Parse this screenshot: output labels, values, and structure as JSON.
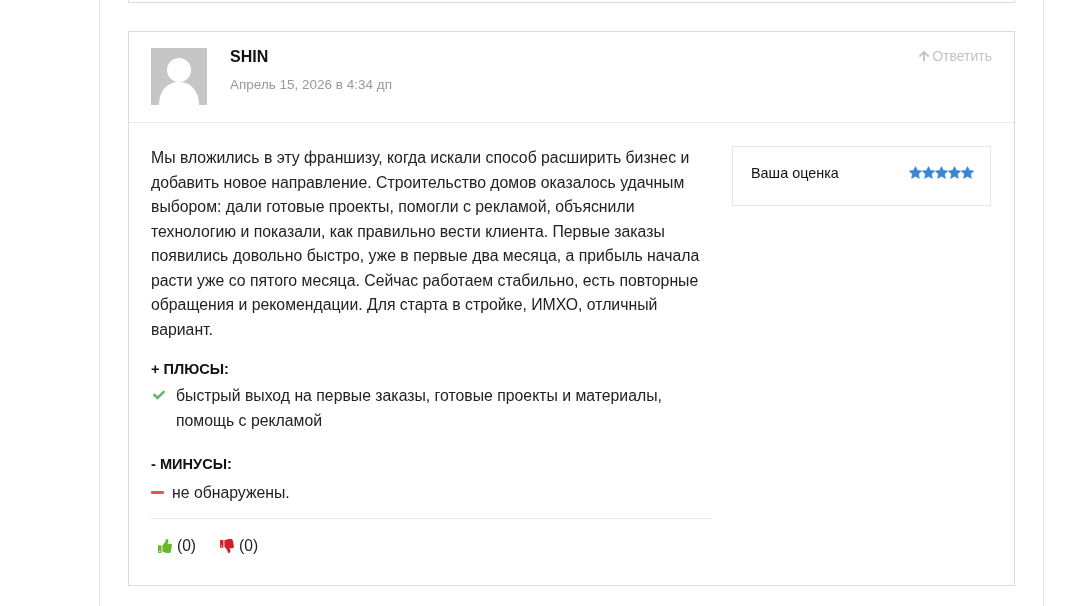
{
  "comment": {
    "author": "SHIN",
    "date": "Апрель 15, 2026 в 4:34 дп",
    "reply_link": "Ответить",
    "text": "Мы вложились в эту франшизу, когда искали способ расширить бизнес и добавить новое направление. Строительство домов оказалось удачным выбором: дали готовые проекты, помогли с рекламой, объяснили технологию и показали, как правильно вести клиента. Первые заказы появились довольно быстро, уже в первые два месяца, а прибыль начала расти уже со пятого месяца. Сейчас работаем стабильно, есть повторные обращения и рекомендации. Для старта в стройке, ИМХО, отличный вариант.",
    "rating": {
      "label": "Ваша оценка",
      "stars": 5
    },
    "sections": [
      {
        "heading": "+ ПЛЮСЫ:",
        "items": [
          {
            "kind": "check",
            "text": "быстрый выход на первые заказы, готовые проекты и материалы, помощь с рекламой"
          }
        ]
      },
      {
        "heading": "- МИНУСЫ:",
        "items": [
          {
            "kind": "dash",
            "text": "не обнаружены."
          }
        ]
      }
    ],
    "votes": [
      {
        "kind": "up",
        "count": "(0)"
      },
      {
        "kind": "down",
        "count": "(0)"
      }
    ]
  }
}
